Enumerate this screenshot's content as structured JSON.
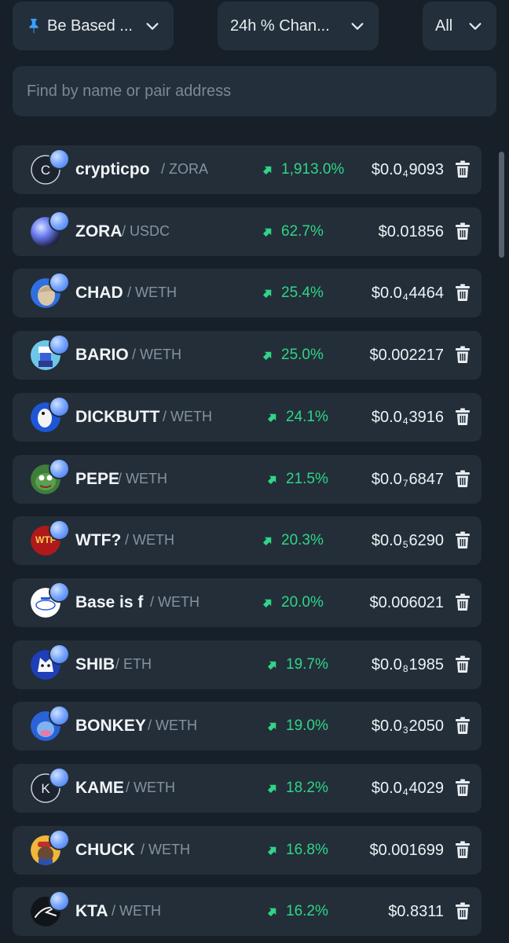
{
  "filters": {
    "list_label": "Be Based ...",
    "sort_label": "24h % Chan...",
    "scope_label": "All"
  },
  "search": {
    "placeholder": "Find by name or pair address"
  },
  "tokens": [
    {
      "name": "crypticpo",
      "pair": "/ ZORA",
      "change": "1,913.0%",
      "price_pre": "$0.0",
      "price_sub": "4",
      "price_post": "9093",
      "avatar": "letter",
      "letter": "C"
    },
    {
      "name": "ZORA",
      "pair": "/ USDC",
      "change": "62.7%",
      "price_pre": "$0.01856",
      "price_sub": "",
      "price_post": "",
      "avatar": "zora"
    },
    {
      "name": "CHAD",
      "pair": "/ WETH",
      "change": "25.4%",
      "price_pre": "$0.0",
      "price_sub": "4",
      "price_post": "4464",
      "avatar": "chad"
    },
    {
      "name": "BARIO",
      "pair": "/ WETH",
      "change": "25.0%",
      "price_pre": "$0.002217",
      "price_sub": "",
      "price_post": "",
      "avatar": "bario"
    },
    {
      "name": "DICKBUTT",
      "pair": "/ WETH",
      "change": "24.1%",
      "price_pre": "$0.0",
      "price_sub": "4",
      "price_post": "3916",
      "avatar": "blue"
    },
    {
      "name": "PEPE",
      "pair": "/ WETH",
      "change": "21.5%",
      "price_pre": "$0.0",
      "price_sub": "7",
      "price_post": "6847",
      "avatar": "pepe"
    },
    {
      "name": "WTF?",
      "pair": "/ WETH",
      "change": "20.3%",
      "price_pre": "$0.0",
      "price_sub": "5",
      "price_post": "6290",
      "avatar": "wtf"
    },
    {
      "name": "Base is f",
      "pair": "/ WETH",
      "change": "20.0%",
      "price_pre": "$0.006021",
      "price_sub": "",
      "price_post": "",
      "avatar": "base"
    },
    {
      "name": "SHIB",
      "pair": "/ ETH",
      "change": "19.7%",
      "price_pre": "$0.0",
      "price_sub": "8",
      "price_post": "1985",
      "avatar": "shib"
    },
    {
      "name": "BONKEY",
      "pair": "/ WETH",
      "change": "19.0%",
      "price_pre": "$0.0",
      "price_sub": "3",
      "price_post": "2050",
      "avatar": "bonkey"
    },
    {
      "name": "KAME",
      "pair": "/ WETH",
      "change": "18.2%",
      "price_pre": "$0.0",
      "price_sub": "4",
      "price_post": "4029",
      "avatar": "letter",
      "letter": "K"
    },
    {
      "name": "CHUCK",
      "pair": "/ WETH",
      "change": "16.8%",
      "price_pre": "$0.001699",
      "price_sub": "",
      "price_post": "",
      "avatar": "chuck"
    },
    {
      "name": "KTA",
      "pair": "/ WETH",
      "change": "16.2%",
      "price_pre": "$0.8311",
      "price_sub": "",
      "price_post": "",
      "avatar": "kta"
    }
  ],
  "icons": {
    "pin": "pin-icon",
    "chevron": "chevron-down-icon",
    "trend": "trend-up-icon",
    "trash": "trash-icon"
  },
  "colors": {
    "background": "#172029",
    "row": "#232e39",
    "positive": "#2fd686",
    "muted": "#8693a0",
    "pin": "#3aa0ff"
  }
}
